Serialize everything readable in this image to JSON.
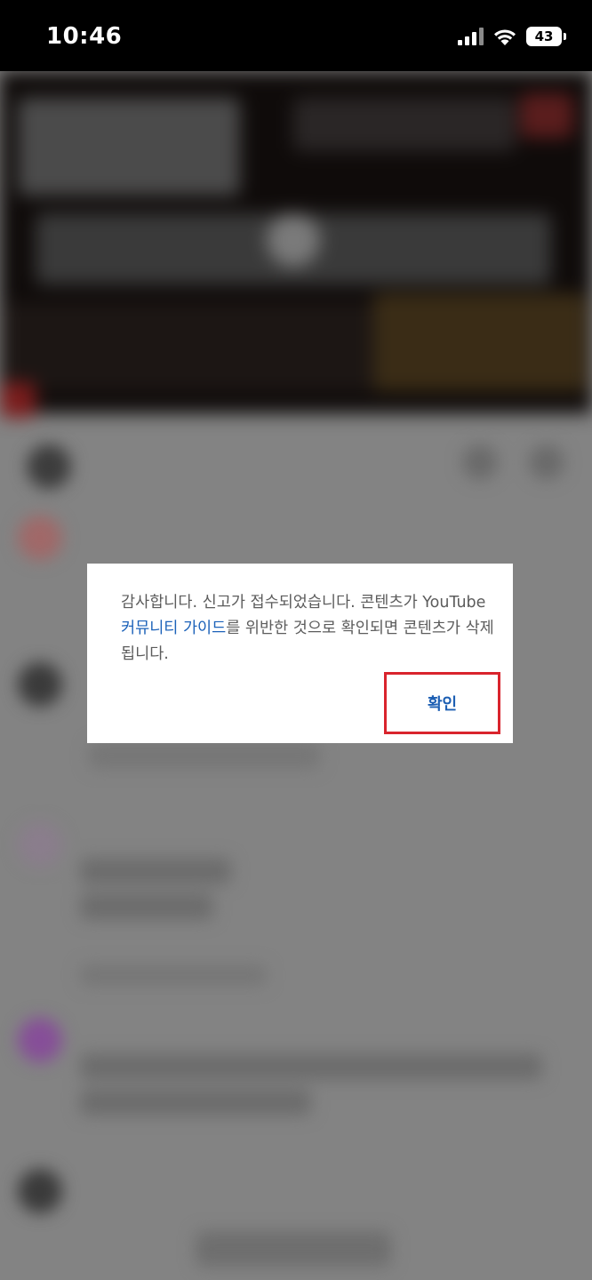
{
  "status_bar": {
    "time": "10:46",
    "battery": "43",
    "signal_icon": "cellular-signal-icon",
    "wifi_icon": "wifi-icon"
  },
  "dialog": {
    "message_part1": "감사합니다. 신고가 접수되었습니다. 콘텐츠가 YouTube ",
    "link_text": "커뮤니티 가이드",
    "message_part2": "를 위반한 것으로 확인되면 콘텐츠가 삭제됩니다.",
    "confirm_label": "확인",
    "link_color": "#1c62b9",
    "highlight_color": "#d9242d"
  }
}
